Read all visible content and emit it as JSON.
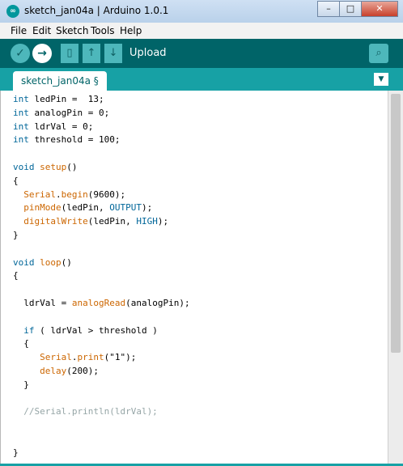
{
  "window": {
    "title": "sketch_jan04a | Arduino 1.0.1"
  },
  "window_buttons": {
    "minimize": "–",
    "maximize": "□",
    "close": "✕"
  },
  "menu": [
    "File",
    "Edit",
    "Sketch",
    "Tools",
    "Help"
  ],
  "toolbar": {
    "label": "Upload",
    "verify_glyph": "✓",
    "upload_glyph": "→",
    "new_glyph": "▯",
    "open_glyph": "↑",
    "save_glyph": "↓",
    "serial_glyph": "⌕"
  },
  "tab": {
    "label": "sketch_jan04a §",
    "menu_glyph": "▼"
  },
  "colors": {
    "toolbar": "#006468",
    "tabstrip": "#17a1a5",
    "keyword": "#cc6600",
    "constant": "#006699",
    "comment": "#95a5a6"
  },
  "code_lines": [
    "int ledPin =  13;",
    "int analogPin = 0;",
    "int ldrVal = 0;",
    "int threshold = 100;",
    "",
    "void setup()",
    "{",
    "  Serial.begin(9600);",
    "  pinMode(ledPin, OUTPUT);",
    "  digitalWrite(ledPin, HIGH);",
    "}",
    "",
    "void loop()",
    "{",
    "",
    "  ldrVal = analogRead(analogPin);",
    "",
    "  if ( ldrVal > threshold )",
    "  {",
    "     Serial.print(\"1\");",
    "     delay(200);",
    "  }",
    "",
    "  //Serial.println(ldrVal);",
    "",
    "",
    "}"
  ]
}
